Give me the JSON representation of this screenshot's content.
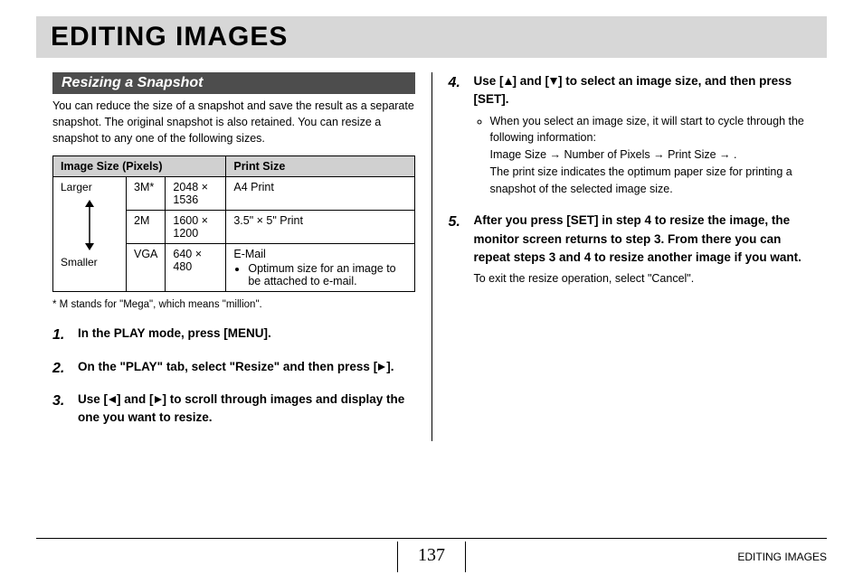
{
  "title": "EDITING IMAGES",
  "section": "Resizing a Snapshot",
  "intro": "You can reduce the size of a snapshot and save the result as a separate snapshot. The original snapshot is also retained. You can resize a snapshot to any one of the following sizes.",
  "table": {
    "header1": "Image Size (Pixels)",
    "header2": "Print Size",
    "scaleTop": "Larger",
    "scaleBottom": "Smaller",
    "rows": [
      {
        "label": "3M*",
        "pixels": "2048 × 1536",
        "print": "A4 Print"
      },
      {
        "label": "2M",
        "pixels": "1600 × 1200",
        "print": "3.5\" × 5\" Print"
      },
      {
        "label": "VGA",
        "pixels": "640 × 480",
        "print": "E-Mail",
        "printNote": "Optimum size for an image to be attached to e-mail."
      }
    ]
  },
  "footnote": "*  M stands for \"Mega\", which means \"million\".",
  "stepsLeft": [
    {
      "main": "In the PLAY mode, press [MENU]."
    },
    {
      "main_pre": "On the \"PLAY\" tab, select \"Resize\" and then press [",
      "icon": "right",
      "main_post": "]."
    },
    {
      "main_pre": "Use [",
      "icon1": "left",
      "main_mid": "] and [",
      "icon2": "right",
      "main_post": "] to scroll through images and display the one you want to resize."
    }
  ],
  "stepsRight": [
    {
      "num": "4",
      "main_pre": "Use [",
      "icon1": "up",
      "main_mid": "] and [",
      "icon2": "down",
      "main_post": "] to select an image size, and then press [SET].",
      "sub_bullet": "When you select an image size, it will start to cycle through the following information:",
      "sub_flow": "Image Size → Number of Pixels → Print Size → .",
      "sub_text": "The print size indicates the optimum paper size for printing a snapshot of the selected image size."
    },
    {
      "num": "5",
      "main": "After you press [SET] in step 4 to resize the image, the monitor screen returns to step 3. From there you can repeat steps 3 and 4 to resize another image if you want.",
      "sub_text": "To exit the resize operation, select \"Cancel\"."
    }
  ],
  "footerLabel": "EDITING IMAGES",
  "pageNumber": "137"
}
